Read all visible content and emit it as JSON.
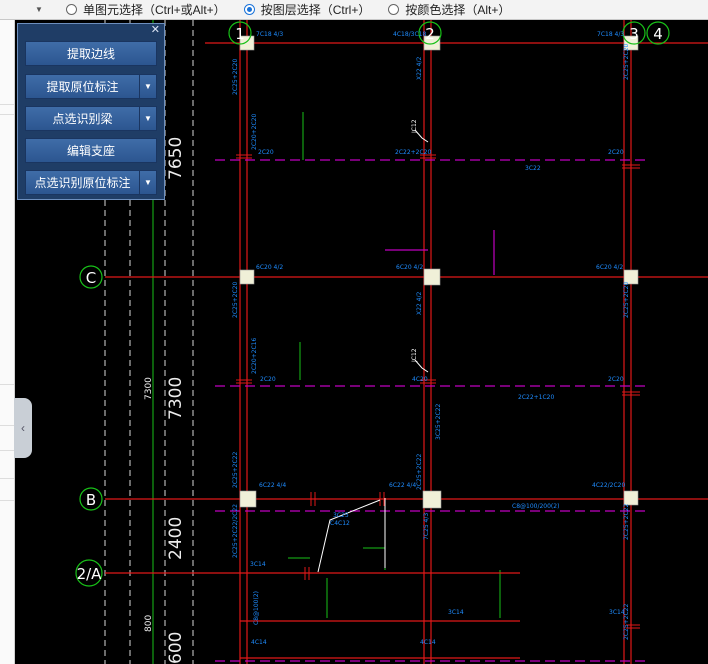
{
  "toolbar": {
    "option1": "单图元选择（Ctrl+或Alt+）",
    "option2": "按图层选择（Ctrl+）",
    "option3": "按颜色选择（Alt+）"
  },
  "panel": {
    "btn1": "提取边线",
    "btn2": "提取原位标注",
    "btn3": "点选识别梁",
    "btn4": "编辑支座",
    "btn5": "点选识别原位标注"
  },
  "axes": {
    "col1": "1",
    "col2": "2",
    "col3": "3",
    "col4": "4",
    "rowC": "C",
    "rowB": "B",
    "rowA2": "2/A"
  },
  "dims": {
    "d1": "7650",
    "d2": "7300",
    "d3": "2400",
    "d4": "600",
    "small1": "7300",
    "small2": "800"
  },
  "labels": {
    "t1": "7C18 4/3",
    "t2": "4C18/3C18",
    "t3": "7C18 4/3",
    "t4": "2C20",
    "t5": "2C22+2C20",
    "t6": "2C20",
    "t7": "3C22",
    "t8": "6C20 4/2",
    "t9": "6C20 4/2",
    "t10": "6C20 4/2",
    "t11": "2C20",
    "t12": "4C20",
    "t13": "2C20",
    "t14": "2C22+1C20",
    "t15": "6C22 4/4",
    "t16": "6C22 4/4",
    "t17": "4C22/2C20",
    "t18": "C8@100/200(2)",
    "t19": "3C14",
    "t20": "3C14",
    "t21": "3C14",
    "t22": "4C14",
    "t23": "4C14",
    "t24": "3C25",
    "t25": "C4C12",
    "v1": "2C25+2C20",
    "v2": "2C20+2C20",
    "v3": "X22 4/2",
    "v4": "2C25+2C20",
    "v5": "2C20+2C16",
    "v6": "2C25+2C22",
    "v7": "2C25+2C22/2C22",
    "v8": "C8@100(2)",
    "v9": "7C25 4/3",
    "v10": "2C25+2C22",
    "v11": "3C25+2C22",
    "v12": "2C25+2C20",
    "v13": "2C25+2C22",
    "x1": "JC12",
    "x2": "JC12"
  },
  "colors": {
    "axis": "#e01818",
    "beam": "#c000c0",
    "text": "#1e8cff",
    "dim": "#e8e8e8",
    "green": "#18c018",
    "column": "#f0f0d8"
  }
}
